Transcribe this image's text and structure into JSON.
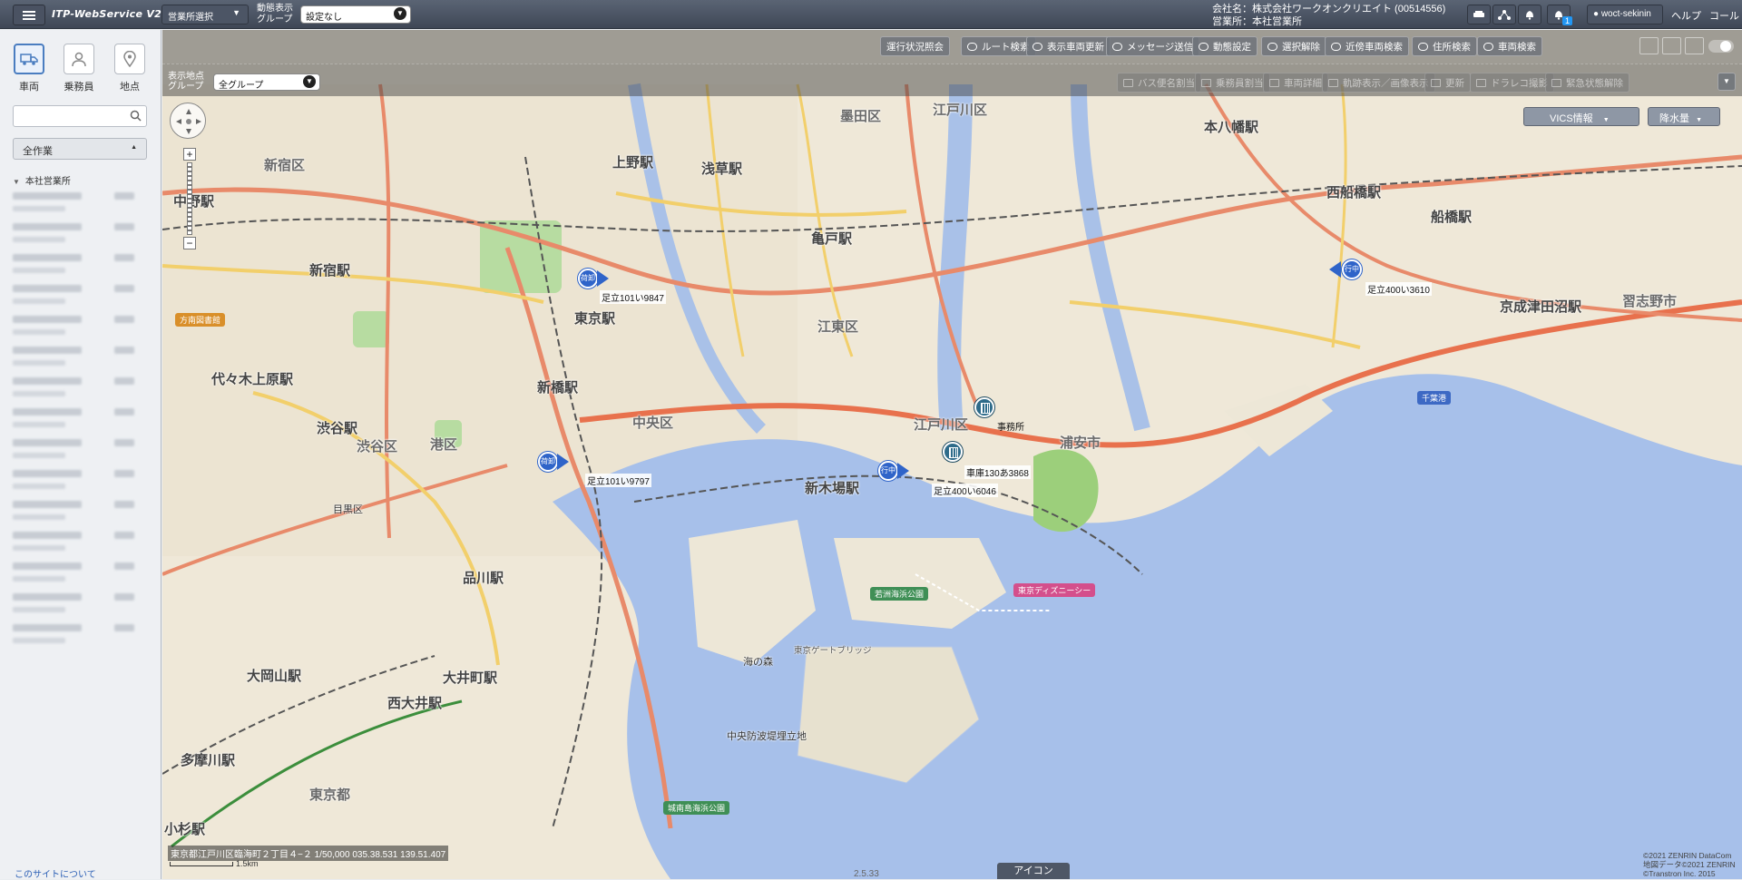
{
  "app": {
    "logo": "ITP-WebService V2",
    "office_select": "営業所選択",
    "anim_group_label_line1": "動態表示",
    "anim_group_label_line2": "グループ",
    "anim_group_value": "設定なし",
    "company_line1": "会社名：株式会社ワークオンクリエイト (00514556)",
    "company_line2": "営業所：本社営業所",
    "notification_count": "1",
    "username": "woct-sekinin",
    "help": "ヘルプ",
    "call": "コール"
  },
  "sidebar": {
    "tabs": [
      {
        "label": "車両",
        "icon": "truck-icon",
        "active": true
      },
      {
        "label": "乗務員",
        "icon": "person-icon",
        "active": false
      },
      {
        "label": "地点",
        "icon": "pin-icon",
        "active": false
      }
    ],
    "search_placeholder": "",
    "work_filter": "全作業",
    "tree_root": "本社営業所",
    "vehicle_row_count_note": "",
    "about_link": "このサイトについて"
  },
  "toolbar1": [
    {
      "label": "運行状況照会",
      "dim": false
    },
    {
      "label": "ルート検索",
      "dim": false
    },
    {
      "label": "表示車両更新",
      "dim": false
    },
    {
      "label": "メッセージ送信",
      "dim": false
    },
    {
      "label": "動態設定",
      "dim": false
    },
    {
      "label": "選択解除",
      "dim": false
    },
    {
      "label": "近傍車両検索",
      "dim": false
    },
    {
      "label": "住所検索",
      "dim": false
    },
    {
      "label": "車両検索",
      "dim": false
    }
  ],
  "toolbar2": {
    "display_group_label_line1": "表示地点",
    "display_group_label_line2": "グループ",
    "display_group_value": "全グループ",
    "buttons": [
      {
        "label": "バス便名割当"
      },
      {
        "label": "乗務員割当"
      },
      {
        "label": "車両詳細"
      },
      {
        "label": "軌跡表示／画像表示"
      },
      {
        "label": "更新"
      },
      {
        "label": "ドラレコ撮影"
      },
      {
        "label": "緊急状態解除"
      }
    ]
  },
  "map": {
    "vics": "VICS情報",
    "rain": "降水量",
    "vehicles": [
      {
        "status": "荷卸",
        "label": "足立101い9847"
      },
      {
        "status": "荷卸",
        "label": "足立101い9797"
      },
      {
        "status": "行中",
        "label": "足立400い6046"
      },
      {
        "status": "行中",
        "label": "足立400い3610"
      }
    ],
    "points": [
      {
        "label": "事務所"
      },
      {
        "label": "車庫130あ3868"
      }
    ],
    "places": [
      {
        "name": "新宿区",
        "cls": "ward"
      },
      {
        "name": "新宿駅",
        "cls": "big"
      },
      {
        "name": "代々木上原駅",
        "cls": "big"
      },
      {
        "name": "渋谷駅",
        "cls": "big"
      },
      {
        "name": "渋谷区",
        "cls": "ward"
      },
      {
        "name": "港区",
        "cls": "ward"
      },
      {
        "name": "上野駅",
        "cls": "big"
      },
      {
        "name": "浅草駅",
        "cls": "big"
      },
      {
        "name": "墨田区",
        "cls": "ward"
      },
      {
        "name": "亀戸駅",
        "cls": "big"
      },
      {
        "name": "江東区",
        "cls": "ward"
      },
      {
        "name": "中央区",
        "cls": "ward"
      },
      {
        "name": "東京駅",
        "cls": "big"
      },
      {
        "name": "新橋駅",
        "cls": "big"
      },
      {
        "name": "品川駅",
        "cls": "big"
      },
      {
        "name": "目黒区",
        "cls": ""
      },
      {
        "name": "大井町駅",
        "cls": "big"
      },
      {
        "name": "西大井駅",
        "cls": "big"
      },
      {
        "name": "大岡山駅",
        "cls": "big"
      },
      {
        "name": "多摩川駅",
        "cls": "big"
      },
      {
        "name": "東京都",
        "cls": "ward"
      },
      {
        "name": "小杉駅",
        "cls": "big"
      },
      {
        "name": "新木場駅",
        "cls": "big"
      },
      {
        "name": "江戸川区",
        "cls": "ward"
      },
      {
        "name": "浦安市",
        "cls": "ward"
      },
      {
        "name": "西船橋駅",
        "cls": "big"
      },
      {
        "name": "船橋駅",
        "cls": "big"
      },
      {
        "name": "京成津田沼駅",
        "cls": "big"
      },
      {
        "name": "習志野市",
        "cls": "ward"
      },
      {
        "name": "本八幡駅",
        "cls": "big"
      },
      {
        "name": "千葉港",
        "cls": "tag"
      },
      {
        "name": "東京ディズニーシー",
        "cls": "tag"
      },
      {
        "name": "海の森",
        "cls": ""
      },
      {
        "name": "中央防波堤埋立地",
        "cls": ""
      },
      {
        "name": "城南島海浜公園",
        "cls": "tag"
      },
      {
        "name": "若洲海浜公園",
        "cls": "tag"
      },
      {
        "name": "東京ゲートブリッジ",
        "cls": "small"
      },
      {
        "name": "江戸川区",
        "cls": "ward"
      },
      {
        "name": "方南図書館",
        "cls": "tag"
      },
      {
        "name": "中野駅",
        "cls": "big"
      }
    ],
    "address": "東京都江戸川区臨海町２丁目４−２ 1/50,000 035.38.531 139.51.407",
    "scale": "1.5km",
    "version": "2.5.33",
    "icon_tab": "アイコン",
    "copyright": [
      "©2021 ZENRIN DataCom",
      "地図データ©2021 ZENRIN",
      "©Transtron Inc. 2015"
    ]
  }
}
